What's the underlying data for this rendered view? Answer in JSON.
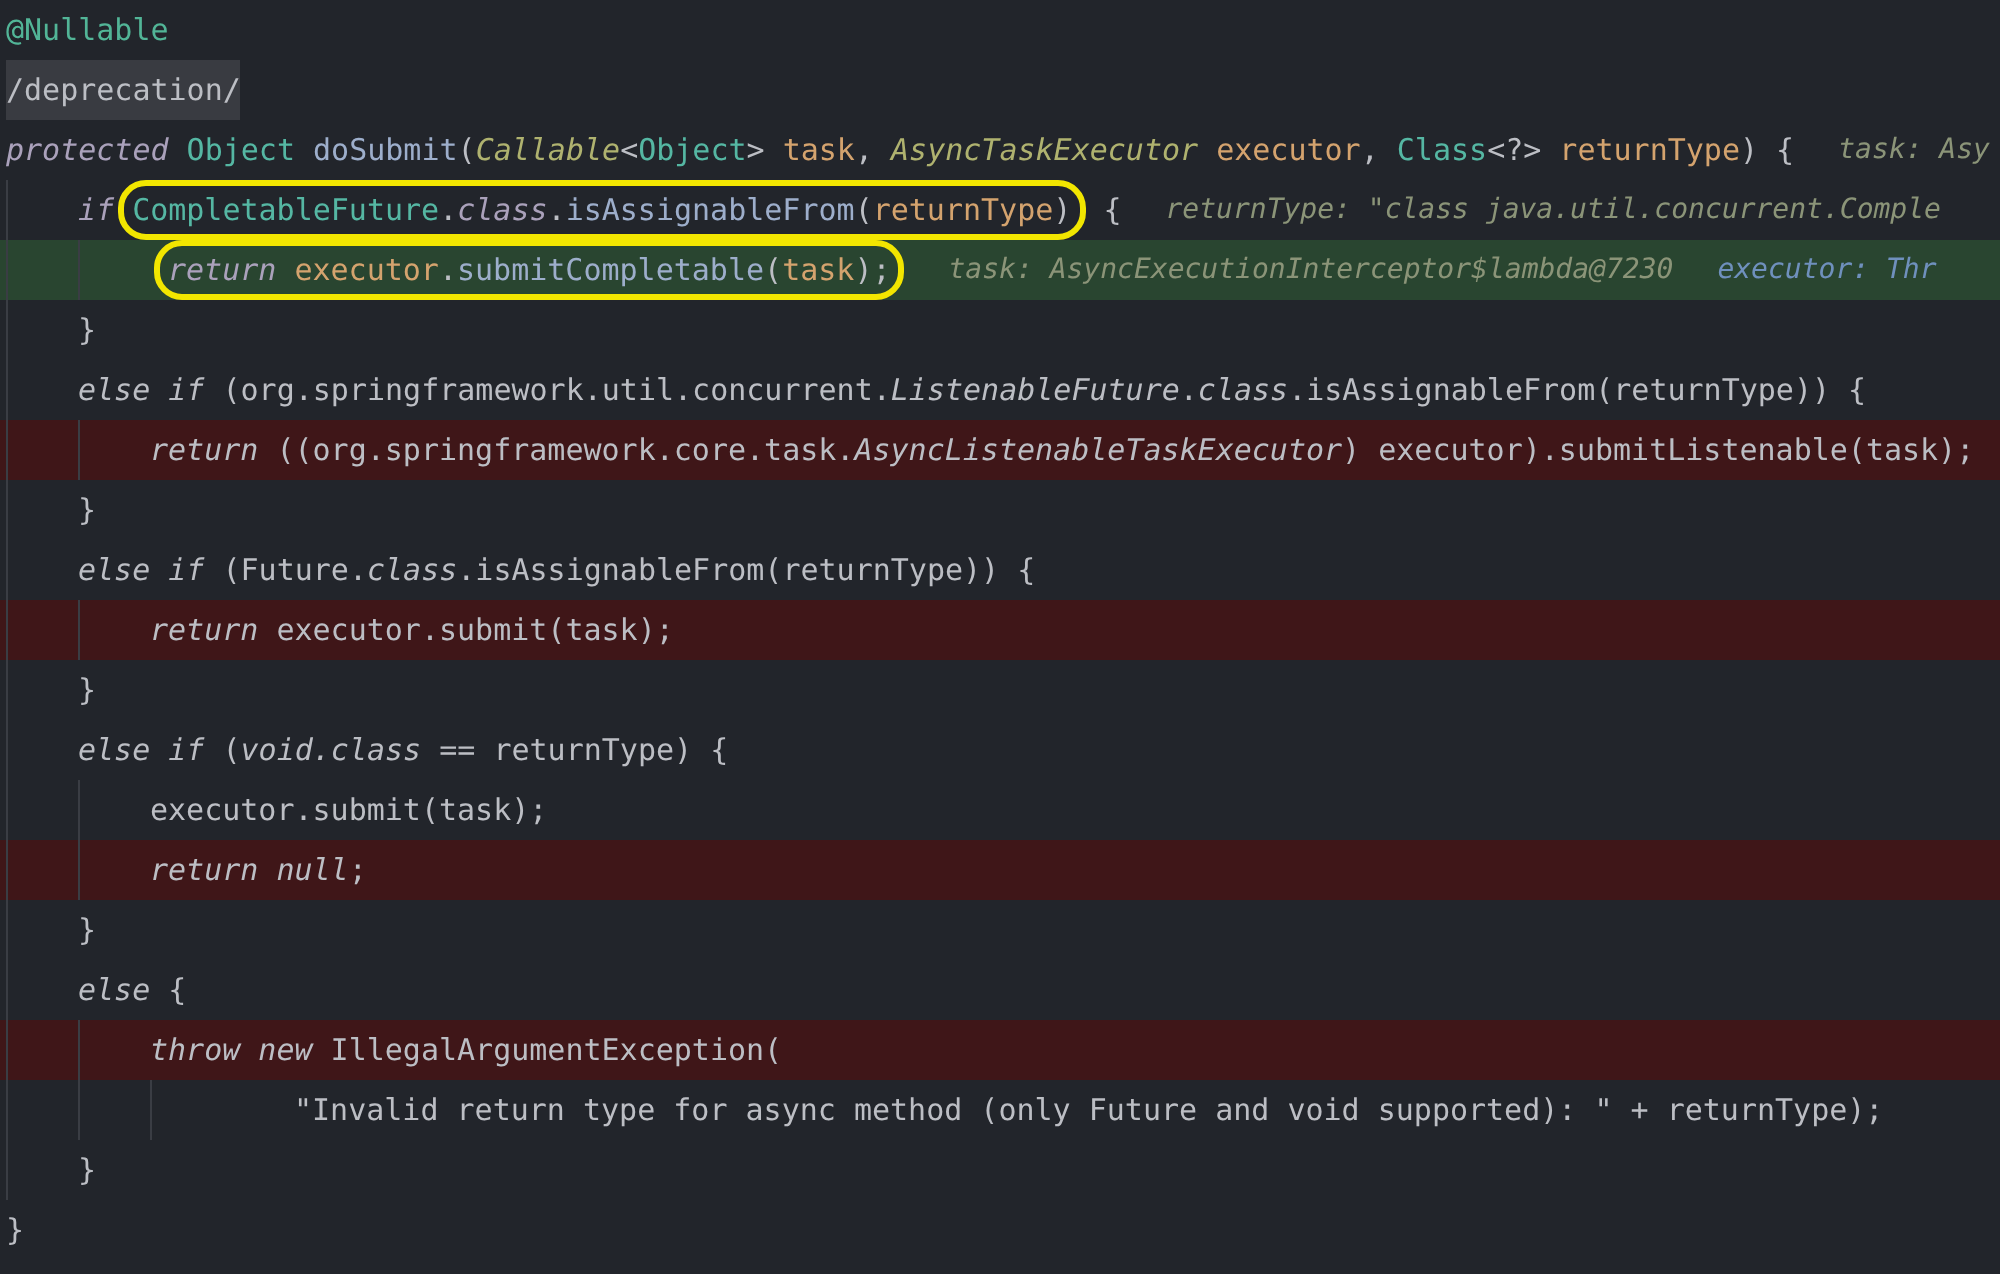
{
  "editor": {
    "lines": [
      {
        "kind": "plain",
        "tokens": [
          {
            "kind": "annotation",
            "text": "@Nullable"
          }
        ]
      },
      {
        "kind": "marker",
        "tokens": [
          {
            "kind": "plain",
            "text": "/deprecation/"
          }
        ]
      },
      {
        "kind": "plain",
        "tokens": [
          {
            "kind": "keyword",
            "text": "protected"
          },
          {
            "kind": "type",
            "text": " Object"
          },
          {
            "kind": "method",
            "text": " doSubmit"
          },
          {
            "kind": "punct",
            "text": "("
          },
          {
            "kind": "interface",
            "text": "Callable"
          },
          {
            "kind": "punct",
            "text": "<"
          },
          {
            "kind": "type",
            "text": "Object"
          },
          {
            "kind": "punct",
            "text": ">"
          },
          {
            "kind": "param",
            "text": " task"
          },
          {
            "kind": "punct",
            "text": ","
          },
          {
            "kind": "interface",
            "text": " AsyncTaskExecutor"
          },
          {
            "kind": "param",
            "text": " executor"
          },
          {
            "kind": "punct",
            "text": ","
          },
          {
            "kind": "type",
            "text": " Class"
          },
          {
            "kind": "punct",
            "text": "<?>"
          },
          {
            "kind": "param",
            "text": " returnType"
          },
          {
            "kind": "punct",
            "text": ") {"
          }
        ],
        "hints": [
          {
            "kind": "value",
            "text": "task: Asy"
          }
        ],
        "children": [
          {
            "kind": "plain",
            "tokens": [
              {
                "kind": "keyword",
                "text": "if"
              },
              {
                "kind": "circled",
                "tokens": [
                  {
                    "kind": "type",
                    "text": "CompletableFuture"
                  },
                  {
                    "kind": "punct",
                    "text": "."
                  },
                  {
                    "kind": "keyword",
                    "text": "class"
                  },
                  {
                    "kind": "punct",
                    "text": "."
                  },
                  {
                    "kind": "method",
                    "text": "isAssignableFrom"
                  },
                  {
                    "kind": "punct",
                    "text": "("
                  },
                  {
                    "kind": "param",
                    "text": "returnType"
                  },
                  {
                    "kind": "punct",
                    "text": ")"
                  }
                ]
              },
              {
                "kind": "punct",
                "text": " {"
              }
            ],
            "hints": [
              {
                "kind": "value",
                "text": "returnType: \"class java.util.concurrent.Comple"
              }
            ],
            "children": [
              {
                "kind": "executed",
                "tokens": [
                  {
                    "kind": "circled",
                    "tokens": [
                      {
                        "kind": "keyword",
                        "text": "return"
                      },
                      {
                        "kind": "param",
                        "text": " executor"
                      },
                      {
                        "kind": "punct",
                        "text": "."
                      },
                      {
                        "kind": "method",
                        "text": "submitCompletable"
                      },
                      {
                        "kind": "punct",
                        "text": "("
                      },
                      {
                        "kind": "param",
                        "text": "task"
                      },
                      {
                        "kind": "punct",
                        "text": ");"
                      }
                    ]
                  }
                ],
                "hints": [
                  {
                    "kind": "value",
                    "text": "task: AsyncExecutionInterceptor$lambda@7230"
                  },
                  {
                    "kind": "object",
                    "text": "executor: Thr"
                  }
                ]
              }
            ]
          },
          {
            "kind": "plain",
            "tokens": [
              {
                "kind": "plain",
                "text": "}"
              }
            ]
          },
          {
            "kind": "plain",
            "tokens": [
              {
                "kind": "italic",
                "text": "else if"
              },
              {
                "kind": "plain",
                "text": " (org.springframework.util.concurrent."
              },
              {
                "kind": "italic",
                "text": "ListenableFuture"
              },
              {
                "kind": "plain",
                "text": "."
              },
              {
                "kind": "italic",
                "text": "class"
              },
              {
                "kind": "plain",
                "text": ".isAssignableFrom(returnType)) {"
              }
            ],
            "children": [
              {
                "kind": "unreached",
                "tokens": [
                  {
                    "kind": "italic",
                    "text": "return"
                  },
                  {
                    "kind": "plain",
                    "text": " ((org.springframework.core.task."
                  },
                  {
                    "kind": "italic",
                    "text": "AsyncListenableTaskExecutor"
                  },
                  {
                    "kind": "plain",
                    "text": ") executor).submitListenable(task);"
                  }
                ]
              }
            ]
          },
          {
            "kind": "plain",
            "tokens": [
              {
                "kind": "plain",
                "text": "}"
              }
            ]
          },
          {
            "kind": "plain",
            "tokens": [
              {
                "kind": "italic",
                "text": "else if"
              },
              {
                "kind": "plain",
                "text": " (Future."
              },
              {
                "kind": "italic",
                "text": "class"
              },
              {
                "kind": "plain",
                "text": ".isAssignableFrom(returnType)) {"
              }
            ],
            "children": [
              {
                "kind": "unreached",
                "tokens": [
                  {
                    "kind": "italic",
                    "text": "return"
                  },
                  {
                    "kind": "plain",
                    "text": " executor.submit(task);"
                  }
                ]
              }
            ]
          },
          {
            "kind": "plain",
            "tokens": [
              {
                "kind": "plain",
                "text": "}"
              }
            ]
          },
          {
            "kind": "plain",
            "tokens": [
              {
                "kind": "italic",
                "text": "else if"
              },
              {
                "kind": "plain",
                "text": " ("
              },
              {
                "kind": "italic",
                "text": "void.class"
              },
              {
                "kind": "plain",
                "text": " == returnType) {"
              }
            ],
            "children": [
              {
                "kind": "plain",
                "tokens": [
                  {
                    "kind": "plain",
                    "text": "executor.submit(task);"
                  }
                ]
              },
              {
                "kind": "unreached",
                "tokens": [
                  {
                    "kind": "italic",
                    "text": "return null"
                  },
                  {
                    "kind": "plain",
                    "text": ";"
                  }
                ]
              }
            ]
          },
          {
            "kind": "plain",
            "tokens": [
              {
                "kind": "plain",
                "text": "}"
              }
            ]
          },
          {
            "kind": "plain",
            "tokens": [
              {
                "kind": "italic",
                "text": "else"
              },
              {
                "kind": "plain",
                "text": " {"
              }
            ],
            "children": [
              {
                "kind": "unreached",
                "tokens": [
                  {
                    "kind": "italic",
                    "text": "throw new"
                  },
                  {
                    "kind": "plain",
                    "text": " IllegalArgumentException("
                  }
                ],
                "children": [
                  {
                    "kind": "continuation",
                    "tokens": [
                      {
                        "kind": "plain",
                        "text": "\"Invalid return type for async method (only Future and void supported): \" + returnType);"
                      }
                    ]
                  }
                ]
              }
            ]
          },
          {
            "kind": "plain",
            "tokens": [
              {
                "kind": "plain",
                "text": "}"
              }
            ]
          }
        ]
      },
      {
        "kind": "plain",
        "tokens": [
          {
            "kind": "plain",
            "text": "}"
          }
        ]
      }
    ]
  }
}
